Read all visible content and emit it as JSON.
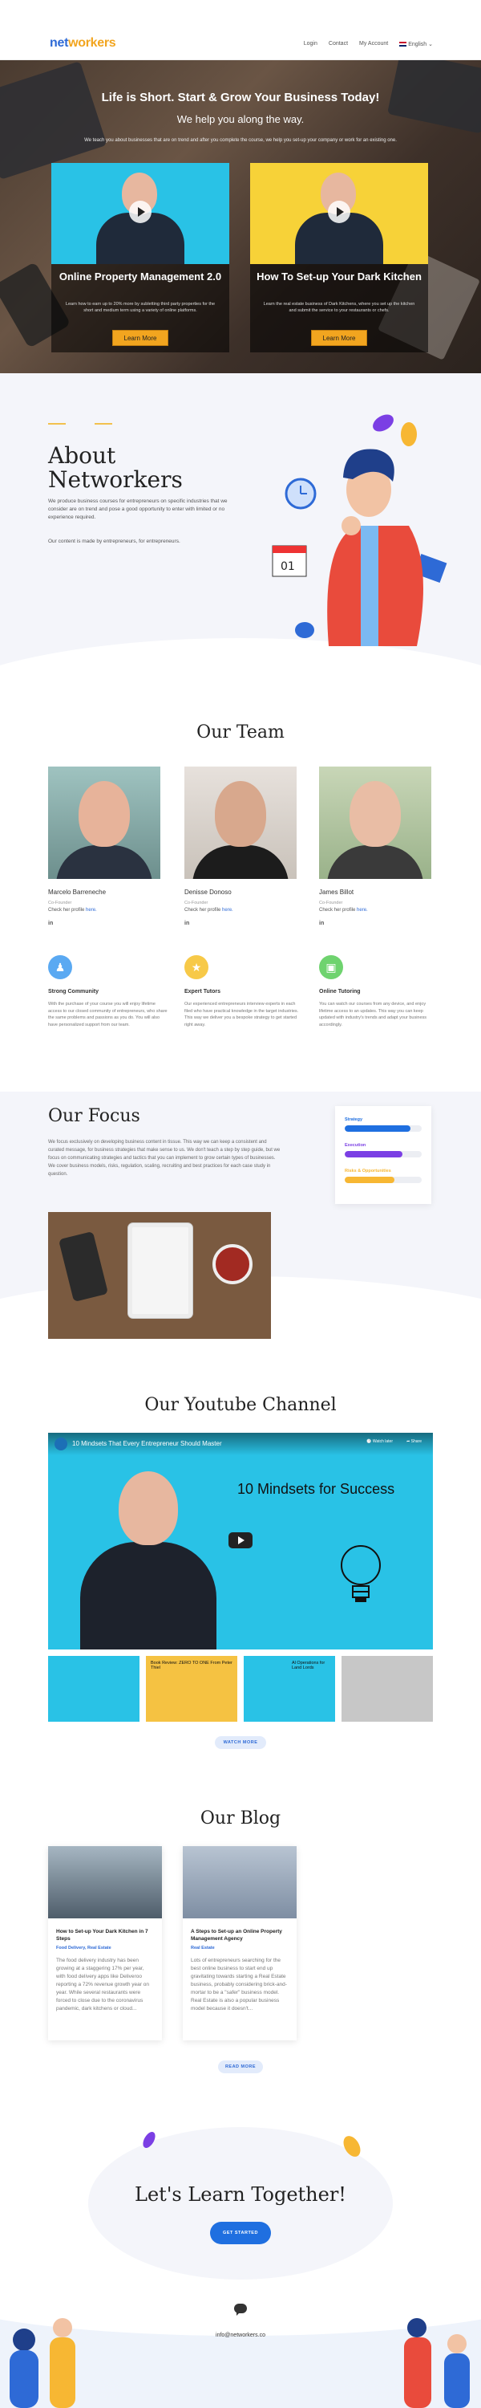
{
  "header": {
    "logo_part1": "net",
    "logo_part2": "workers",
    "nav": [
      "Login",
      "Contact",
      "My Account"
    ],
    "language": "English"
  },
  "hero": {
    "title": "Life is Short. Start & Grow Your Business Today!",
    "subtitle": "We help you along the way.",
    "description": "We teach you about businesses that are on trend and after you complete the course, we help you set-up your company or work for an existing one.",
    "courses": [
      {
        "title": "Online Property Management 2.0",
        "description": "Learn how to earn up to 20% more by subletting third party properties for the short and medium term using a variety of online platforms.",
        "button": "Learn More"
      },
      {
        "title": "How To Set-up Your Dark Kitchen",
        "description": "Learn the real estate business of Dark Kitchens, where you set up the kitchen and submit the service to your restaurants or chefs.",
        "button": "Learn More"
      }
    ]
  },
  "about": {
    "title": "About Networkers",
    "p1": "We produce business courses for entrepreneurs on specific industries that we consider are on trend and pose a good opportunity to enter with limited or no experience required.",
    "p2": "Our content is made by entrepreneurs, for entrepreneurs.",
    "calendar_day": "01"
  },
  "team": {
    "title": "Our Team",
    "members": [
      {
        "name": "Marcelo Barreneche",
        "role": "Co-Founder",
        "profile_text": "Check her profile",
        "profile_link": "here.",
        "social": "in"
      },
      {
        "name": "Denisse Donoso",
        "role": "Co-Founder",
        "profile_text": "Check her profile",
        "profile_link": "here.",
        "social": "in"
      },
      {
        "name": "James Billot",
        "role": "Co-Founder",
        "profile_text": "Check her profile",
        "profile_link": "here.",
        "social": "in"
      }
    ],
    "features": [
      {
        "title": "Strong Community",
        "color": "#5aa9f2",
        "description": "With the purchase of your course you will enjoy lifetime access to our closed community of entrepreneurs, who share the same problems and passions as you do. You will also have personalized support from our team."
      },
      {
        "title": "Expert Tutors",
        "color": "#f7c948",
        "description": "Our experienced entrepreneurs interview experts in each filed who have practical knowledge in the target industries. This way we deliver you a bespoke strategy to get started right away."
      },
      {
        "title": "Online Tutoring",
        "color": "#6fd36f",
        "description": "You can watch our courses from any device, and enjoy lifetime access to an updates. This way you can keep updated with industry's trends and adapt your business accordingly."
      }
    ]
  },
  "focus": {
    "title": "Our Focus",
    "description": "We focus exclusively on developing business content in tissue. This way we can keep a consistent and curated message, for business strategies that make sense to us. We don't teach a step by step guide, but we focus on communicating strategies and tactics that you can implement to grow certain types of businesses. We cover business models, risks, regulation, scaling, recruiting and best practices for each case study in question.",
    "bars": [
      {
        "label": "Strategy",
        "percent": 85,
        "color": "#1f6fe0"
      },
      {
        "label": "Execution",
        "percent": 75,
        "color": "#7b3fe4"
      },
      {
        "label": "Risks & Opportunities",
        "percent": 65,
        "color": "#f7b733"
      }
    ]
  },
  "youtube": {
    "title": "Our Youtube Channel",
    "video_title": "10 Mindsets That Every Entrepreneur Should Master",
    "watch_later": "Watch later",
    "share": "Share",
    "thumbnail_text": "10 Mindsets for Success",
    "thumbs": [
      "",
      "Book Review: ZERO TO ONE From Peter Thiel",
      "Al Operations for Land Lords",
      ""
    ],
    "button": "WATCH MORE"
  },
  "blog": {
    "title": "Our Blog",
    "posts": [
      {
        "title": "How to Set-up Your Dark Kitchen in 7 Steps",
        "category": "Food Delivery, Real Estate",
        "excerpt": "The food delivery industry has been growing at a staggering 17% per year, with food delivery apps like Deliveroo reporting a 72% revenue growth year on year. While several restaurants were forced to close due to the coronavirus pandemic, dark kitchens or cloud..."
      },
      {
        "title": "A Steps to Set-up an Online Property Management Agency",
        "category": "Real Estate",
        "excerpt": "Lots of entrepreneurs searching for the best online business to start end up gravitating towards starting a Real Estate business, probably considering brick-and-mortar to be a \"safer\" business model. Real Estate is also a popular business model because it doesn't..."
      }
    ],
    "button": "READ MORE"
  },
  "cta": {
    "title": "Let's Learn Together!",
    "button": "GET STARTED",
    "email": "info@networkers.co"
  }
}
